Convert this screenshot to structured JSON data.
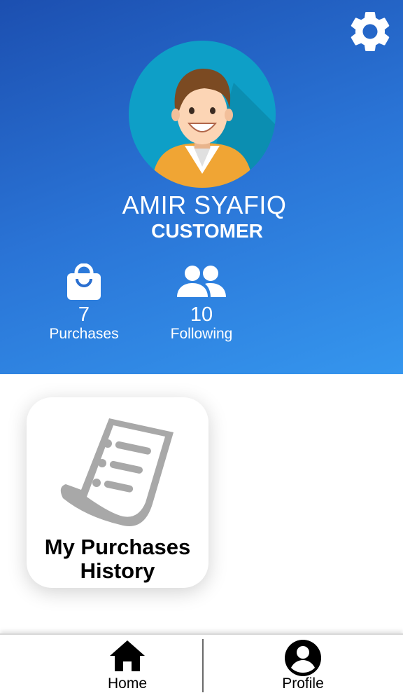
{
  "profile": {
    "name": "AMIR SYAFIQ",
    "role": "CUSTOMER",
    "settings_icon": "gear-icon",
    "avatar_icon": "avatar-icon"
  },
  "stats": [
    {
      "icon": "shopping-bag-icon",
      "value": "7",
      "label": "Purchases"
    },
    {
      "icon": "people-icon",
      "value": "10",
      "label": "Following"
    }
  ],
  "menu": {
    "purchases_history": {
      "icon": "receipt-icon",
      "line1": "My Purchases",
      "line2": "History"
    }
  },
  "bottom_nav": {
    "home": {
      "icon": "home-icon",
      "label": "Home"
    },
    "profile": {
      "icon": "account-circle-icon",
      "label": "Profile"
    }
  },
  "colors": {
    "header_gradient_start": "#1c4fb0",
    "header_gradient_end": "#3596ee",
    "avatar_bg": "#0e9fc7",
    "card_icon": "#a8a8a8"
  }
}
